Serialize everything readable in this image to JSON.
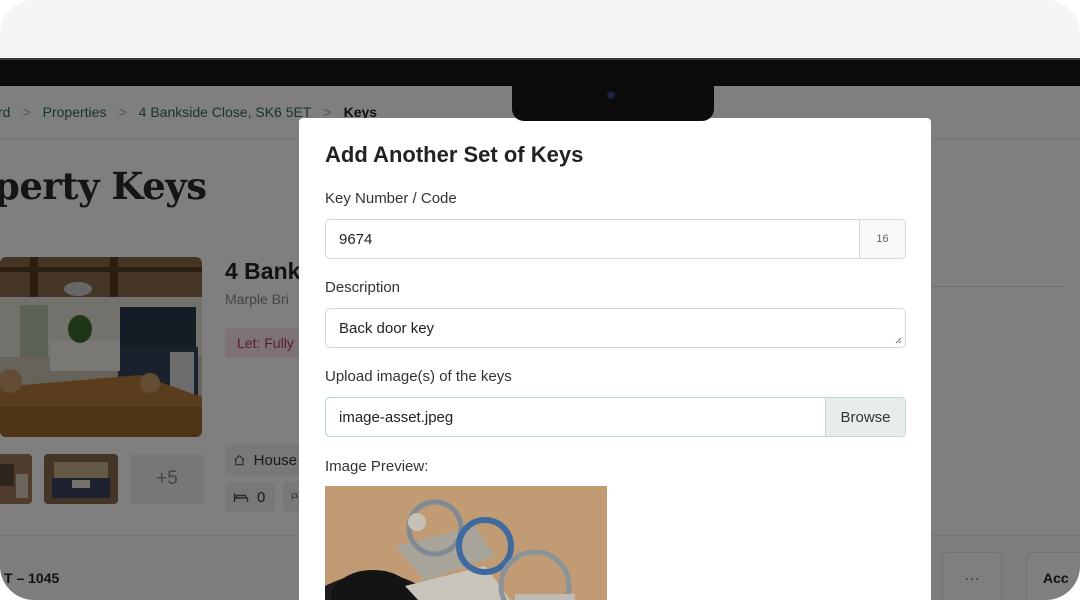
{
  "breadcrumb": {
    "items": [
      "rd",
      "Properties",
      "4 Bankside Close, SK6 5ET",
      "Keys"
    ],
    "separator": ">"
  },
  "page": {
    "title": "perty Keys"
  },
  "property": {
    "name": "4 Bank",
    "area": "Marple Bri",
    "status_badge": "Let: Fully",
    "more_photos": "+5",
    "type_chip": "House",
    "bedrooms": "0"
  },
  "key_card": {
    "reference": "T – 1045",
    "more_label": "···",
    "action_label": "Acc"
  },
  "modal": {
    "title": "Add Another Set of Keys",
    "key_number": {
      "label": "Key Number / Code",
      "value": "9674",
      "counter": "16"
    },
    "description": {
      "label": "Description",
      "value": "Back door key"
    },
    "upload": {
      "label": "Upload image(s) of the keys",
      "file_name": "image-asset.jpeg",
      "browse_label": "Browse"
    },
    "preview": {
      "label": "Image Preview:"
    }
  },
  "colors": {
    "breadcrumb_link": "#2d6a5a",
    "badge_bg": "#fbe4ec",
    "badge_text": "#b43a67",
    "backdrop": "rgba(0,0,0,0.5)"
  },
  "icons": [
    "house-icon",
    "bed-icon",
    "flag-icon",
    "camera-icon"
  ]
}
